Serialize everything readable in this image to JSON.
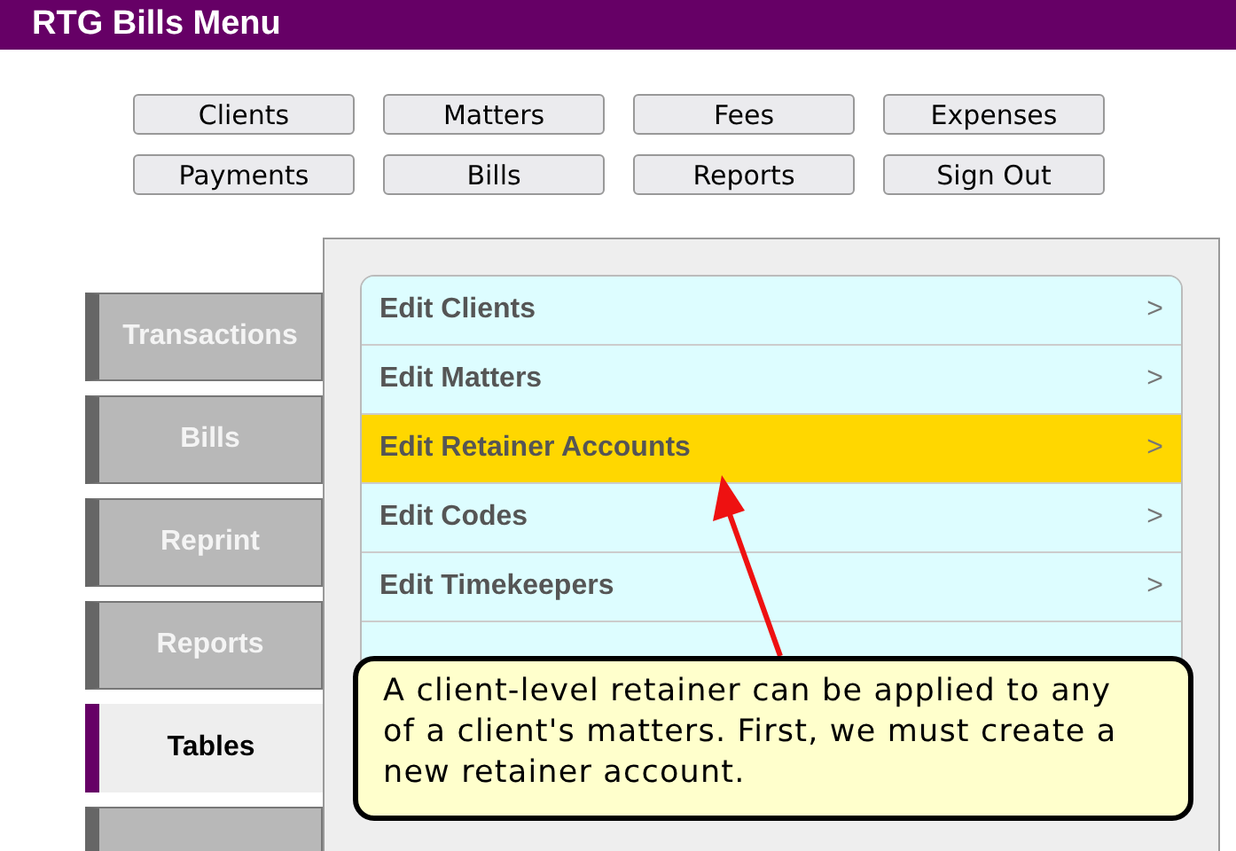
{
  "header": {
    "title": "RTG Bills Menu"
  },
  "nav_buttons": [
    "Clients",
    "Matters",
    "Fees",
    "Expenses",
    "Payments",
    "Bills",
    "Reports",
    "Sign Out"
  ],
  "side_tabs": [
    {
      "label": "Transactions",
      "selected": false
    },
    {
      "label": "Bills",
      "selected": false
    },
    {
      "label": "Reprint",
      "selected": false
    },
    {
      "label": "Reports",
      "selected": false
    },
    {
      "label": "Tables",
      "selected": true
    },
    {
      "selected": false
    }
  ],
  "menu_items": [
    {
      "label": "Edit Clients",
      "chevron": ">",
      "selected": false
    },
    {
      "label": "Edit Matters",
      "chevron": ">",
      "selected": false
    },
    {
      "label": "Edit Retainer Accounts",
      "chevron": ">",
      "selected": true
    },
    {
      "label": "Edit Codes",
      "chevron": ">",
      "selected": false
    },
    {
      "label": "Edit Timekeepers",
      "chevron": ">",
      "selected": false
    }
  ],
  "callout": {
    "text": "A client-level retainer can be applied to any of a client's matters. First, we must create a new retainer account."
  }
}
